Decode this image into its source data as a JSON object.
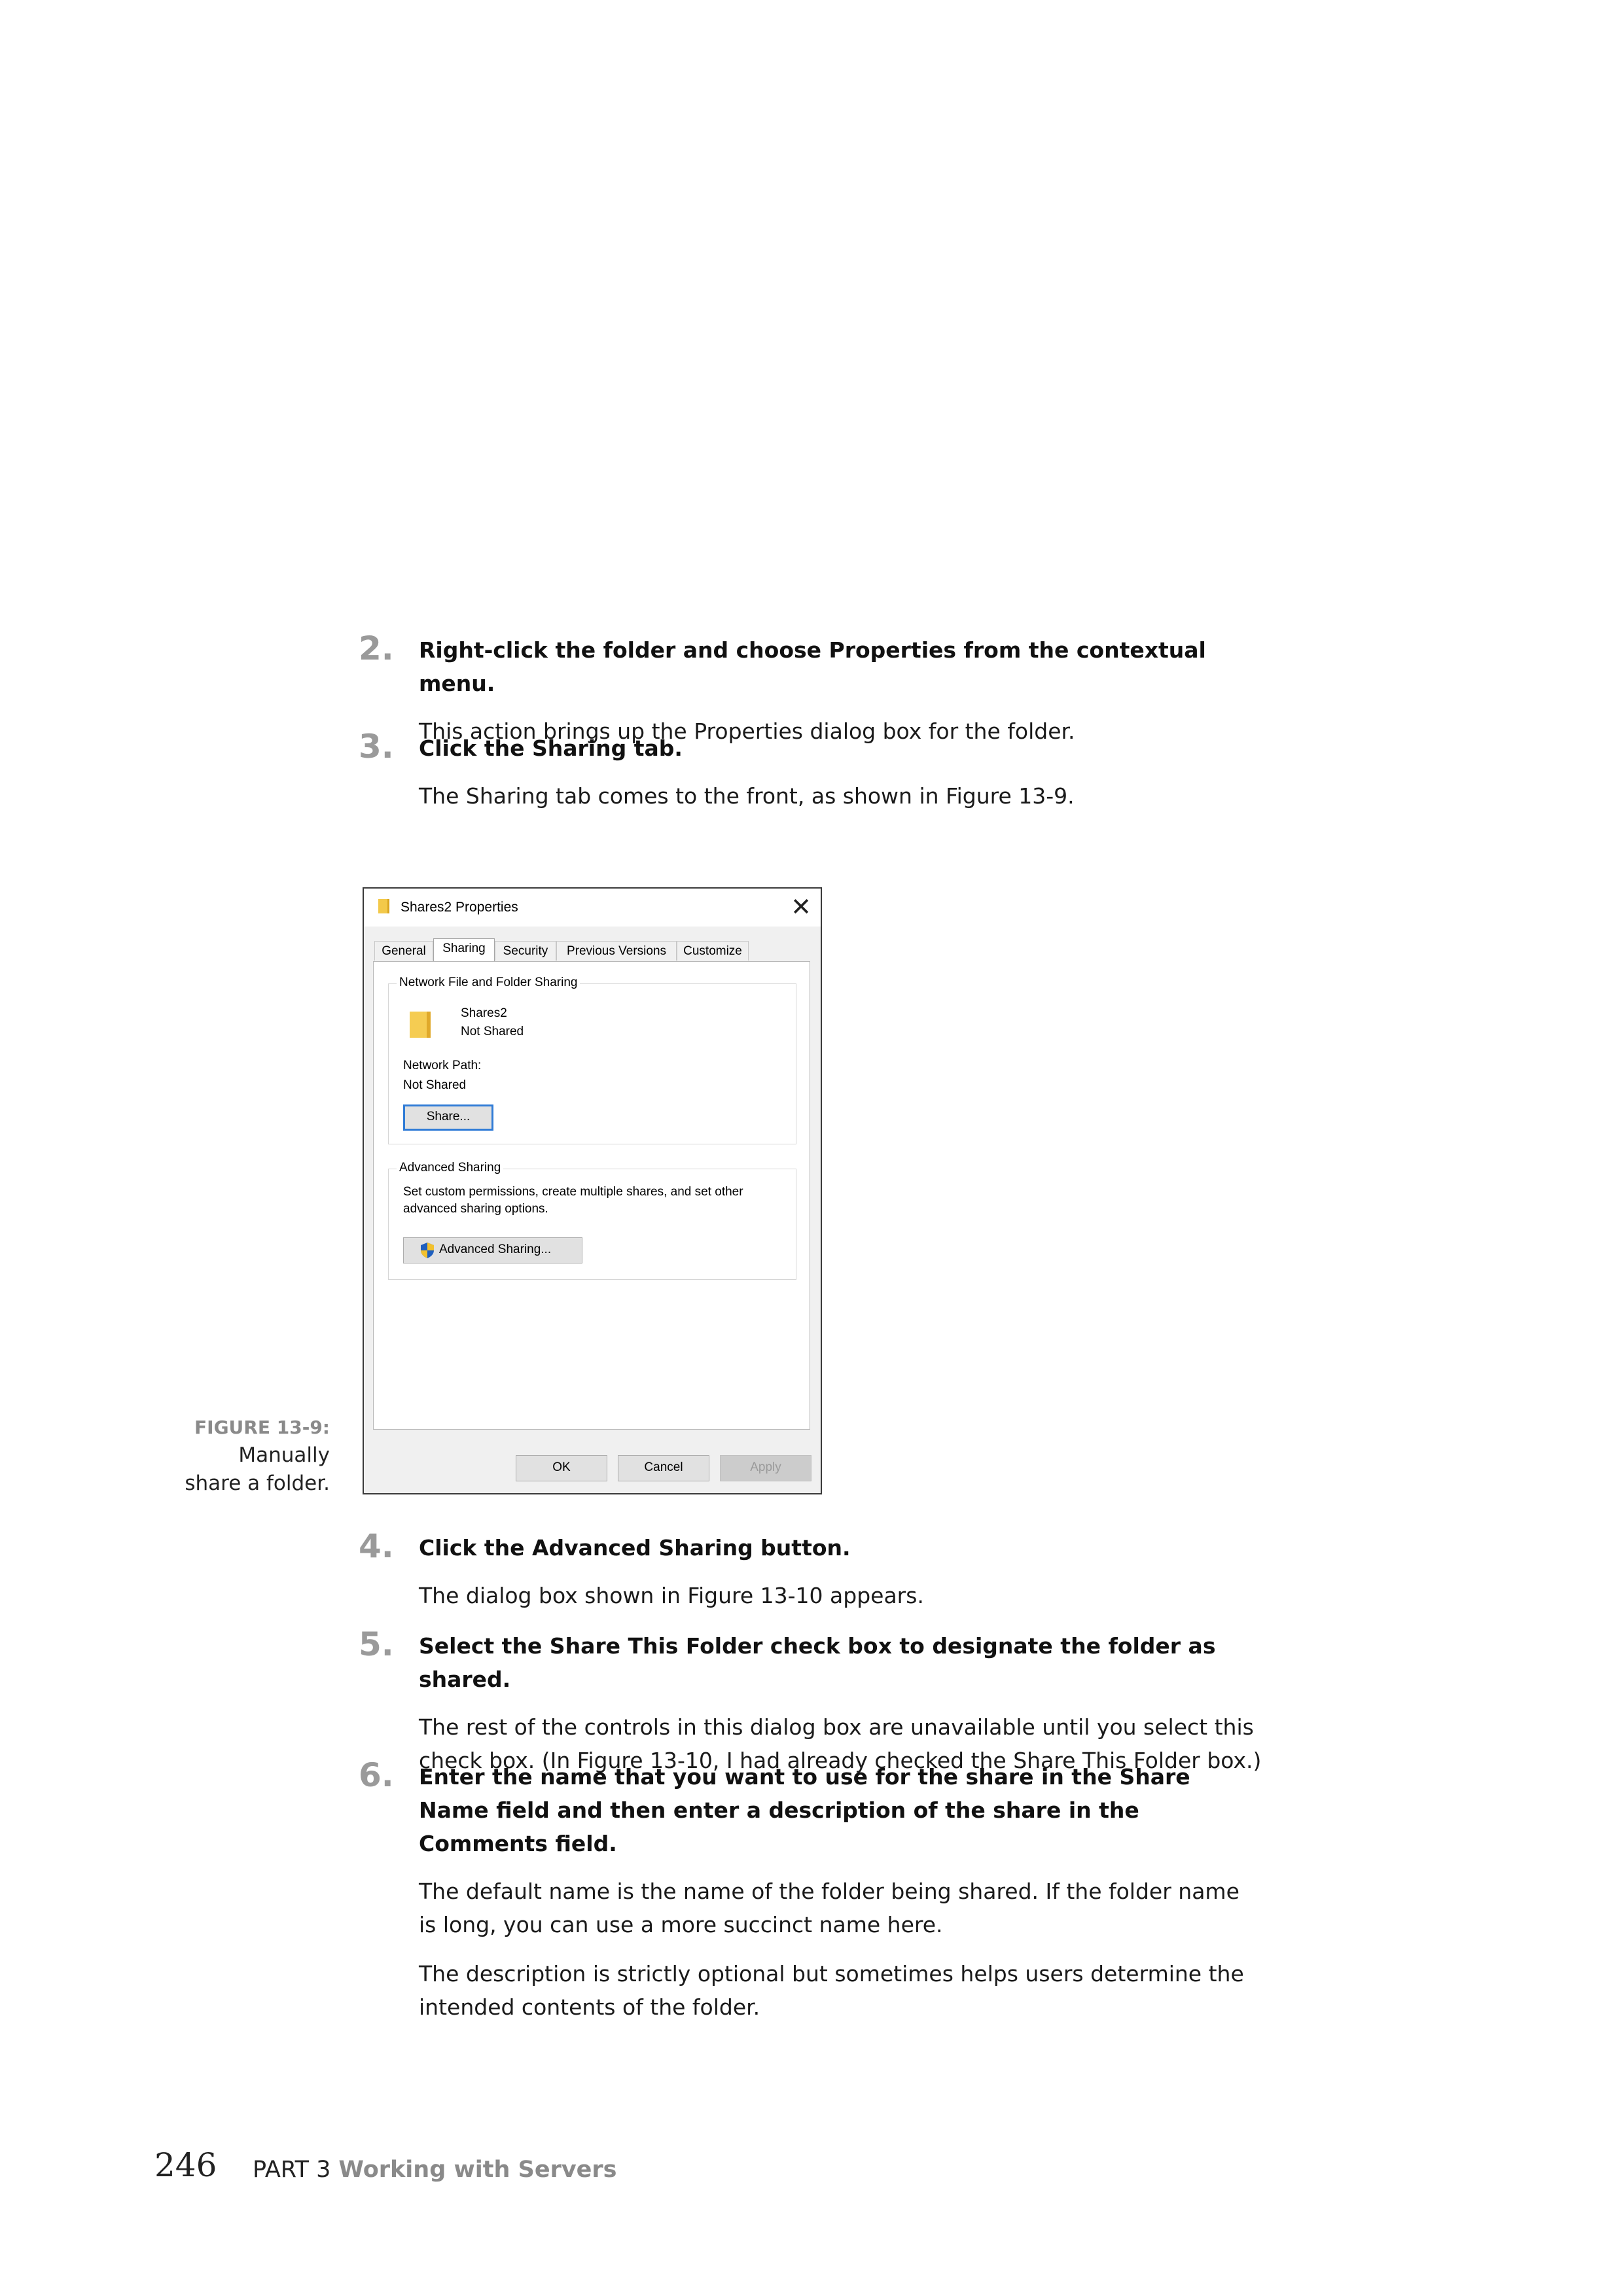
{
  "steps": [
    {
      "num": "2.",
      "head": "Right-click the folder and choose Properties from the contextual menu.",
      "body": [
        "This action brings up the Properties dialog box for the folder."
      ]
    },
    {
      "num": "3.",
      "head": "Click the Sharing tab.",
      "body": [
        "The Sharing tab comes to the front, as shown in Figure 13-9."
      ]
    },
    {
      "num": "4.",
      "head": "Click the Advanced Sharing button.",
      "body": [
        "The dialog box shown in Figure 13-10 appears."
      ]
    },
    {
      "num": "5.",
      "head": "Select the Share This Folder check box to designate the folder as shared.",
      "body": [
        "The rest of the controls in this dialog box are unavailable until you select this check box. (In Figure 13-10, I had already checked the Share This Folder box.)"
      ]
    },
    {
      "num": "6.",
      "head": "Enter the name that you want to use for the share in the Share Name field and then enter a description of the share in the Comments field.",
      "body": [
        "The default name is the name of the folder being shared. If the folder name is long, you can use a more succinct name here.",
        "The description is strictly optional but sometimes helps users determine the intended contents of the folder."
      ]
    }
  ],
  "figure": {
    "label": "FIGURE 13-9:",
    "caption_line1": "Manually",
    "caption_line2": "share a folder."
  },
  "dialog": {
    "title": "Shares2 Properties",
    "close": "✕",
    "tabs": [
      "General",
      "Sharing",
      "Security",
      "Previous Versions",
      "Customize"
    ],
    "active_tab": "Sharing",
    "network_group": "Network File and Folder Sharing",
    "folder_name": "Shares2",
    "folder_status": "Not Shared",
    "network_path_label": "Network Path:",
    "network_path_value": "Not Shared",
    "share_button": "Share...",
    "advanced_group": "Advanced Sharing",
    "advanced_desc_line1": "Set custom permissions, create multiple shares, and set other",
    "advanced_desc_line2": "advanced sharing options.",
    "advanced_button": "Advanced Sharing...",
    "ok": "OK",
    "cancel": "Cancel",
    "apply": "Apply"
  },
  "footer": {
    "page_number": "246",
    "part": "PART 3",
    "section": "Working with Servers"
  }
}
